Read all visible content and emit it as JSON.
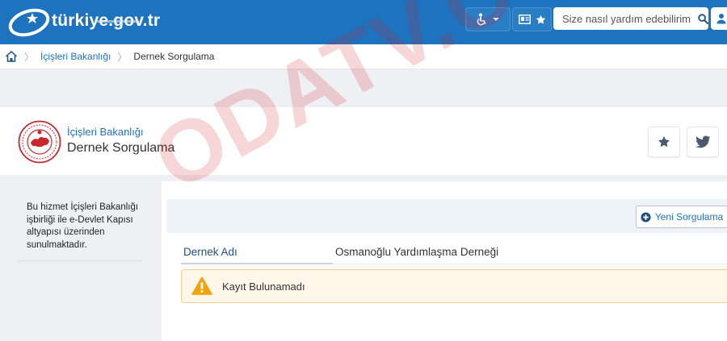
{
  "header": {
    "logo_text": "türkiye.gov.tr",
    "search_placeholder": "Size nasıl yardım edebilirim?"
  },
  "breadcrumb": {
    "items": [
      "İçişleri Bakanlığı",
      "Dernek Sorgulama"
    ]
  },
  "service": {
    "ministry": "İçişleri Bakanlığı",
    "title": "Dernek Sorgulama"
  },
  "sidebar": {
    "info": "Bu hizmet İçişleri Bakanlığı işbirliği ile e-Devlet Kapısı altyapısı üzerinden sunulmaktadır."
  },
  "main": {
    "new_query_label": "Yeni Sorgulama",
    "field_label": "Dernek Adı",
    "field_value": "Osmanoğlu Yardımlaşma Derneği",
    "alert_text": "Kayıt Bulunamadı"
  },
  "watermark": "ODATV.COM",
  "colors": {
    "brand_blue": "#1e73be",
    "alert_bg": "#fff8ea",
    "alert_icon": "#f0a30a",
    "emblem_red": "#c8282e"
  },
  "icons": [
    "accessibility-icon",
    "chevron-down-icon",
    "id-card-icon",
    "star-icon",
    "search-icon",
    "user-icon",
    "home-icon",
    "plus-circle-icon",
    "twitter-icon",
    "warning-icon"
  ]
}
